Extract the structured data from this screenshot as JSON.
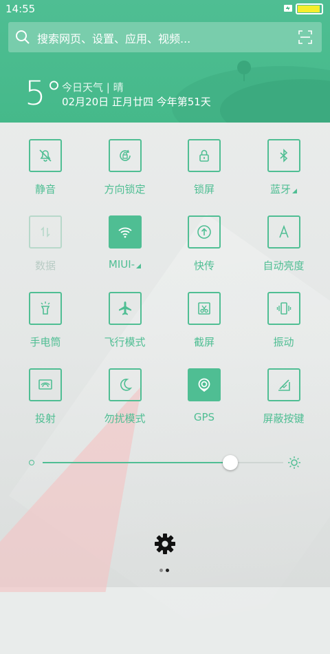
{
  "status": {
    "time": "14:55"
  },
  "search": {
    "placeholder": "搜索网页、设置、应用、视频..."
  },
  "weather": {
    "temp": "5°",
    "line1": "今日天气 | 晴",
    "line2": "02月20日  正月廿四  今年第51天"
  },
  "tiles": [
    {
      "label": "静音",
      "icon": "bell-off-icon",
      "state": "off"
    },
    {
      "label": "方向锁定",
      "icon": "rotation-lock-icon",
      "state": "off"
    },
    {
      "label": "锁屏",
      "icon": "lock-icon",
      "state": "off"
    },
    {
      "label": "蓝牙",
      "icon": "bluetooth-icon",
      "state": "off",
      "caret": true
    },
    {
      "label": "数据",
      "icon": "data-arrows-icon",
      "state": "disabled"
    },
    {
      "label": "MIUI-",
      "icon": "wifi-icon",
      "state": "active",
      "caret": true
    },
    {
      "label": "快传",
      "icon": "quick-share-icon",
      "state": "off"
    },
    {
      "label": "自动亮度",
      "icon": "auto-brightness-icon",
      "state": "off"
    },
    {
      "label": "手电筒",
      "icon": "flashlight-icon",
      "state": "off"
    },
    {
      "label": "飞行模式",
      "icon": "airplane-icon",
      "state": "off"
    },
    {
      "label": "截屏",
      "icon": "screenshot-icon",
      "state": "off"
    },
    {
      "label": "振动",
      "icon": "vibrate-icon",
      "state": "off"
    },
    {
      "label": "投射",
      "icon": "cast-icon",
      "state": "off"
    },
    {
      "label": "勿扰模式",
      "icon": "moon-icon",
      "state": "off"
    },
    {
      "label": "GPS",
      "icon": "gps-icon",
      "state": "active"
    },
    {
      "label": "屏蔽按键",
      "icon": "block-keys-icon",
      "state": "off"
    }
  ],
  "brightness": {
    "level": 0.78
  },
  "pager": {
    "current": 2,
    "total": 2
  },
  "colors": {
    "accent": "#4fbe93"
  }
}
